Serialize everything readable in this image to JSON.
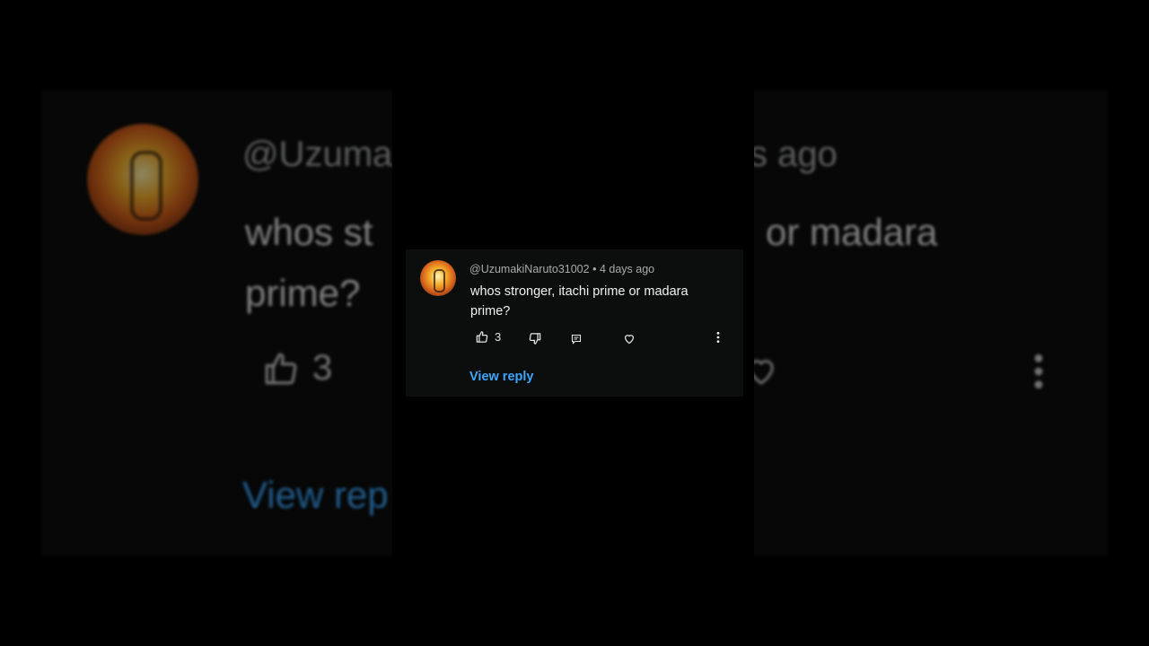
{
  "comment": {
    "handle": "@UzumakiNaruto31002",
    "separator": "•",
    "time_ago": "4 days ago",
    "text": "whos stronger, itachi prime or madara prime?",
    "like_count": "3",
    "view_reply_label": "View reply"
  },
  "background_zoom": {
    "handle_fragment_left": "@Uzumal",
    "handle_fragment_right": "s ago",
    "text_fragment_left": "whos st",
    "text_fragment_right": "or madara",
    "text_line2": "prime?",
    "like_count": "3",
    "view_reply_fragment": "View rep"
  },
  "icons": {
    "like": "thumbs-up-icon",
    "dislike": "thumbs-down-icon",
    "reply": "reply-icon",
    "heart": "heart-icon",
    "more": "more-vertical-icon"
  },
  "colors": {
    "background": "#000000",
    "card": "#0c0e0d",
    "text": "#f1f1f1",
    "meta": "#aaaaaa",
    "link": "#3ea6ff"
  }
}
